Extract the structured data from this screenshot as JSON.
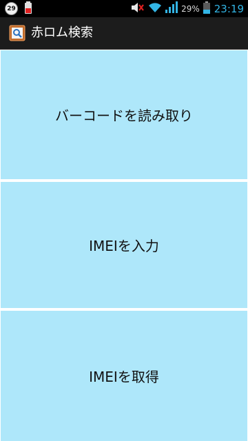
{
  "status_bar": {
    "notification_count": "29",
    "battery_percent": "29%",
    "time": "23:19",
    "icons": [
      "notification-badge-icon",
      "battery-alert-icon",
      "volume-muted-icon",
      "wifi-icon",
      "signal-icon",
      "battery-icon"
    ]
  },
  "action_bar": {
    "title": "赤ロム検索",
    "icon": "app-search-icon"
  },
  "buttons": [
    {
      "label": "バーコードを読み取り"
    },
    {
      "label": "IMEIを入力"
    },
    {
      "label": "IMEIを取得"
    }
  ],
  "colors": {
    "button_bg": "#aee7fa",
    "action_bar_bg": "#1c1c1c",
    "status_bar_bg": "#000000",
    "clock": "#33b5e5"
  }
}
